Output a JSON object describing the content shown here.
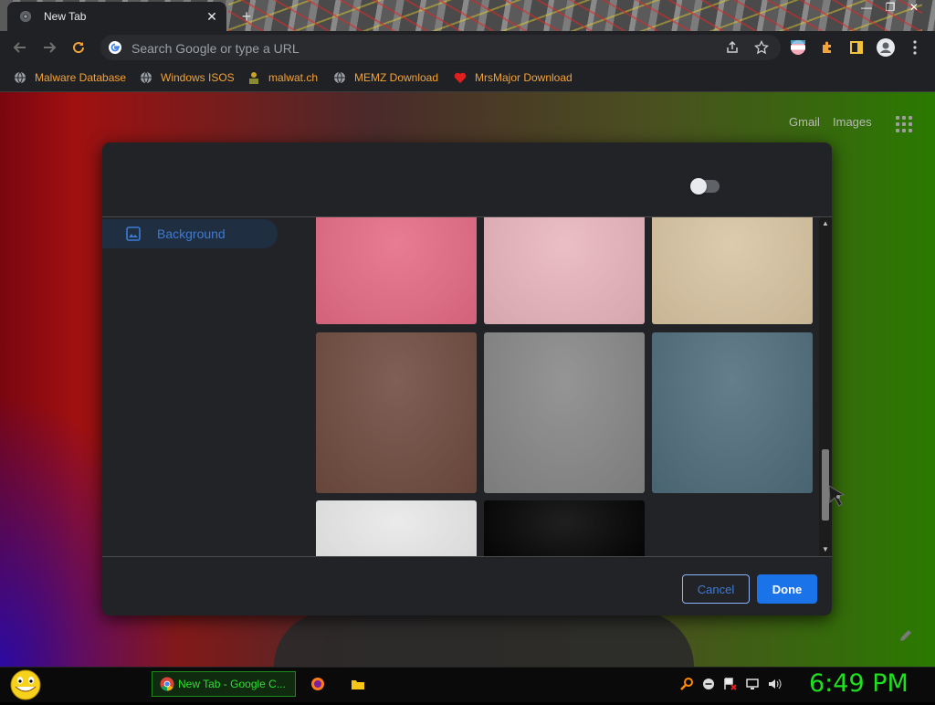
{
  "browser": {
    "tab_title": "New Tab",
    "omnibox_placeholder": "Search Google or type a URL"
  },
  "bookmarks": [
    {
      "label": "Malware Database",
      "icon": "globe-icon"
    },
    {
      "label": "Windows ISOS",
      "icon": "globe-icon"
    },
    {
      "label": "malwat.ch",
      "icon": "person-icon"
    },
    {
      "label": "MEMZ Download",
      "icon": "globe-icon"
    },
    {
      "label": "MrsMajor Download",
      "icon": "heart-icon"
    }
  ],
  "ntp": {
    "gmail_label": "Gmail",
    "images_label": "Images"
  },
  "customize_dialog": {
    "sidebar_items": [
      {
        "label": "Background",
        "icon": "image-icon"
      }
    ],
    "toggle_on": false,
    "tiles": [
      {
        "color": "#e46a84"
      },
      {
        "color": "#e8b4bc"
      },
      {
        "color": "#d8c4a2"
      },
      {
        "color": "#6e4a3e"
      },
      {
        "color": "#868686"
      },
      {
        "color": "#4f6c7a"
      },
      {
        "color": "#e8e8e8"
      },
      {
        "color": "#000000"
      }
    ],
    "cancel_label": "Cancel",
    "done_label": "Done"
  },
  "taskbar": {
    "task_label": "New Tab - Google C...",
    "clock": "6:49 PM"
  },
  "colors": {
    "accent": "#1a73e8",
    "bookmark_text": "#f2a33a",
    "clock": "#1fe01f"
  }
}
